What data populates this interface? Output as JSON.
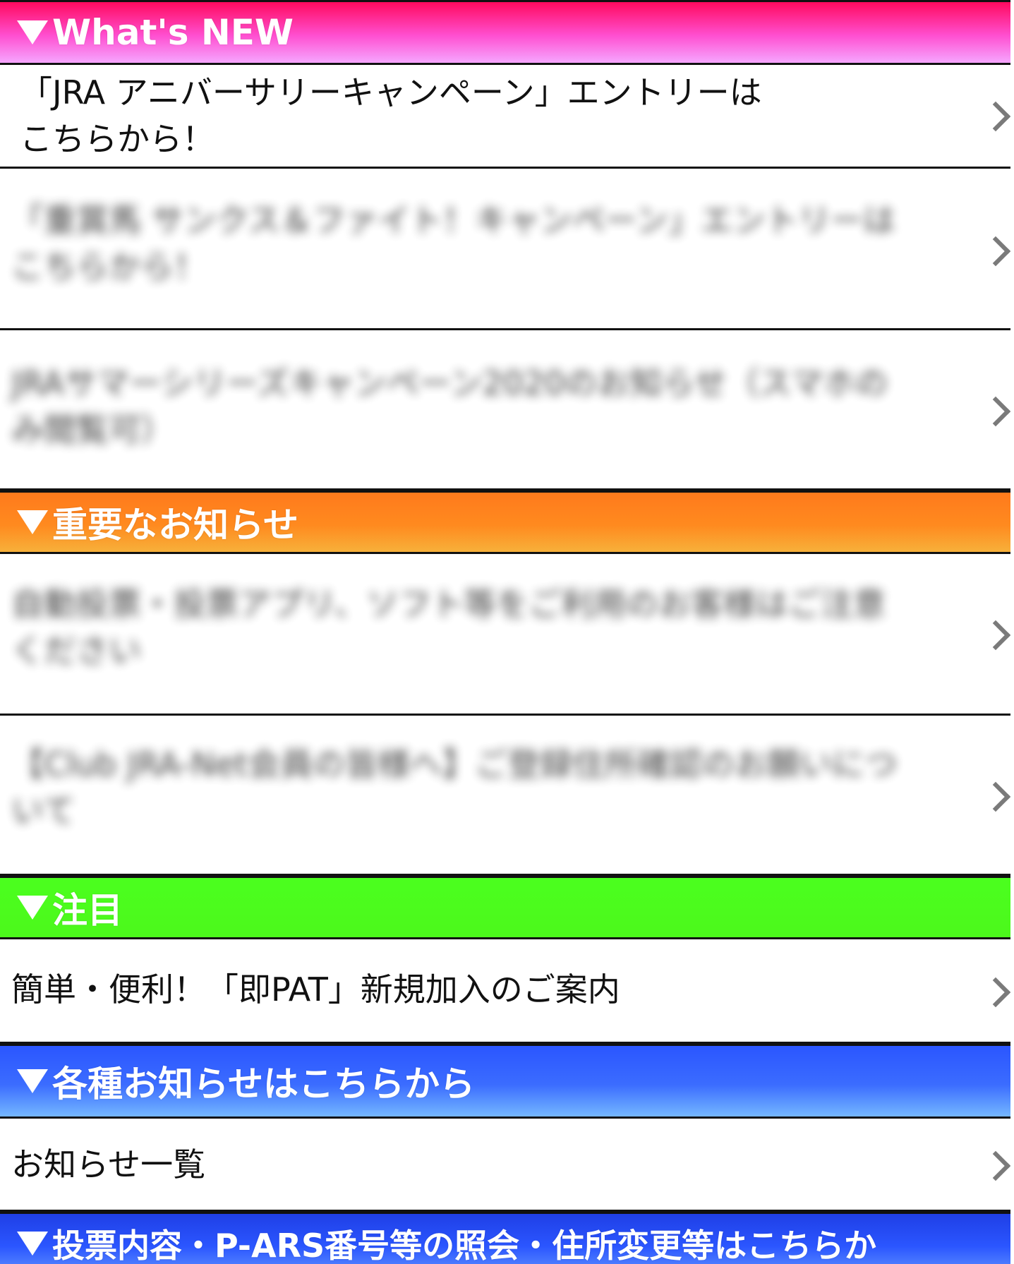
{
  "sections": [
    {
      "title": "What's NEW",
      "items": [
        {
          "label": "「JRA アニバーサリーキャンペーン」エントリーは\nこちらから！"
        },
        {
          "label": "「重賞馬 サンクス＆ファイト！キャンペーン」エントリーはこちらから！",
          "obscured": true
        },
        {
          "label": "JRAサマーシリーズキャンペーン2020のお知らせ（スマホのみ閲覧可）",
          "obscured": true
        }
      ]
    },
    {
      "title": "重要なお知らせ",
      "items": [
        {
          "label": "自動投票・投票アプリ、ソフト等をご利用のお客様はご注意ください",
          "obscured": true
        },
        {
          "label": "【Club JRA-Net会員の皆様へ】ご登録住所確認のお願いについて",
          "obscured": true
        }
      ]
    },
    {
      "title": "注目",
      "items": [
        {
          "label": "簡単・便利！「即PAT」新規加入のご案内"
        }
      ]
    },
    {
      "title": "各種お知らせはこちらから",
      "items": [
        {
          "label": "お知らせ一覧"
        }
      ]
    },
    {
      "title": "投票内容・P-ARS番号等の照会・住所変更等はこちらか"
    }
  ],
  "icons": {
    "section_marker": "triangle-down-icon",
    "row_arrow": "chevron-right-icon"
  },
  "colors": {
    "whats_new": "#ff1f6e",
    "important": "#ff8a1f",
    "featured": "#4cff1e",
    "notices": "#2b56ff",
    "inquiry": "#2346f0"
  }
}
